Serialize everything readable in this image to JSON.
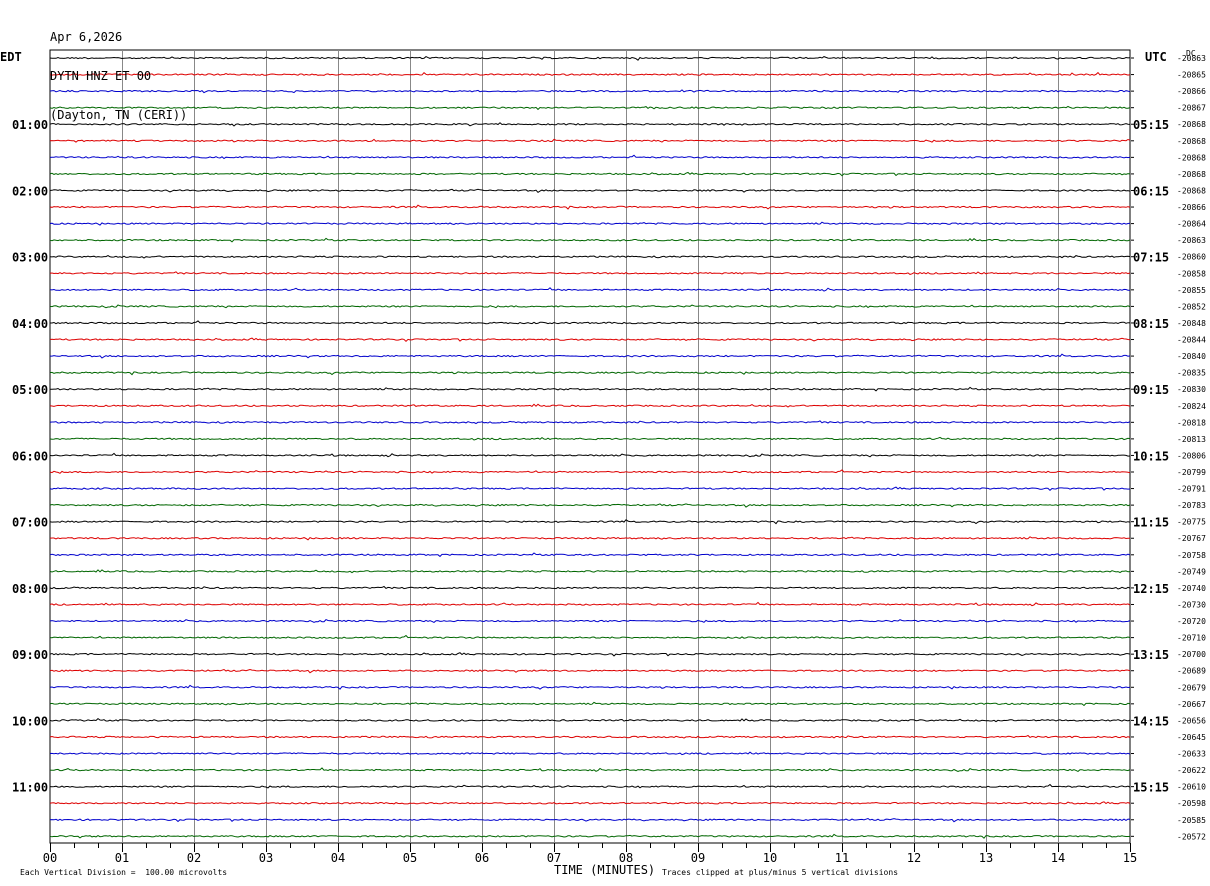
{
  "header": {
    "date": "Apr 6,2026",
    "station": "DYTN HNZ ET 00",
    "location": "(Dayton, TN (CERI))"
  },
  "tz_left": "EDT",
  "tz_right": "UTC",
  "dc_label": "DC",
  "footer": {
    "scale_note": "Each Vertical Division =  100.00 microvolts",
    "clip_note": "Traces clipped at plus/minus 5 vertical divisions",
    "x_title": "TIME (MINUTES)"
  },
  "chart_data": {
    "type": "line",
    "title": "DYTN HNZ ET 00",
    "xlabel": "TIME (MINUTES)",
    "xlim": [
      0,
      15
    ],
    "x_ticks": [
      "00",
      "01",
      "02",
      "03",
      "04",
      "05",
      "06",
      "07",
      "08",
      "09",
      "10",
      "11",
      "12",
      "13",
      "14",
      "15"
    ],
    "trace_colors": [
      "#000000",
      "#dd0000",
      "#0000cc",
      "#006600"
    ],
    "grid": true,
    "left_time_labels": [
      "01:00",
      "02:00",
      "03:00",
      "04:00",
      "05:00",
      "06:00",
      "07:00",
      "08:00",
      "09:00",
      "10:00",
      "11:00"
    ],
    "right_time_labels": [
      "05:15",
      "06:15",
      "07:15",
      "08:15",
      "09:15",
      "10:15",
      "11:15",
      "12:15",
      "13:15",
      "14:15",
      "15:15"
    ],
    "time_label_rows": [
      4,
      8,
      12,
      16,
      20,
      24,
      28,
      32,
      36,
      40,
      44
    ],
    "dc_offsets": [
      "-20863",
      "-20865",
      "-20866",
      "-20867",
      "-20868",
      "-20868",
      "-20868",
      "-20868",
      "-20868",
      "-20866",
      "-20864",
      "-20863",
      "-20860",
      "-20858",
      "-20855",
      "-20852",
      "-20848",
      "-20844",
      "-20840",
      "-20835",
      "-20830",
      "-20824",
      "-20818",
      "-20813",
      "-20806",
      "-20799",
      "-20791",
      "-20783",
      "-20775",
      "-20767",
      "-20758",
      "-20749",
      "-20740",
      "-20730",
      "-20720",
      "-20710",
      "-20700",
      "-20689",
      "-20679",
      "-20667",
      "-20656",
      "-20645",
      "-20633",
      "-20622",
      "-20610",
      "-20598",
      "-20585",
      "-20572"
    ]
  }
}
